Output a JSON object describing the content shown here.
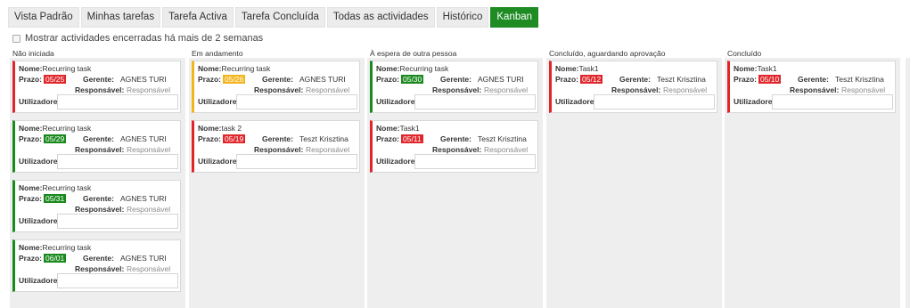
{
  "tabs": [
    {
      "label": "Vista Padrão"
    },
    {
      "label": "Minhas tarefas"
    },
    {
      "label": "Tarefa Activa"
    },
    {
      "label": "Tarefa Concluída"
    },
    {
      "label": "Todas as actividades"
    },
    {
      "label": "Histórico"
    },
    {
      "label": "Kanban",
      "active": true
    }
  ],
  "filter": {
    "show_closed_label": "Mostrar actividades encerradas há mais de 2 semanas",
    "checked": false
  },
  "labels": {
    "name": "Nome:",
    "deadline": "Prazo:",
    "manager": "Gerente:",
    "responsible": "Responsável:",
    "users": "Utilizadores:"
  },
  "colors": {
    "active_tab": "#1e8b23",
    "overdue": "#e0262b",
    "on_time": "#1a8a1f",
    "warning": "#f3b51d"
  },
  "columns": [
    {
      "title": "Não iniciada",
      "cards": [
        {
          "name": "Recurring task",
          "deadline": "05/25",
          "status": "red",
          "manager": "AGNES TURI",
          "responsible": "Responsável"
        },
        {
          "name": "Recurring task",
          "deadline": "05/29",
          "status": "green",
          "manager": "AGNES TURI",
          "responsible": "Responsável"
        },
        {
          "name": "Recurring task",
          "deadline": "05/31",
          "status": "green",
          "manager": "AGNES TURI",
          "responsible": "Responsável"
        },
        {
          "name": "Recurring task",
          "deadline": "06/01",
          "status": "green",
          "manager": "AGNES TURI",
          "responsible": "Responsável"
        }
      ]
    },
    {
      "title": "Em andamento",
      "cards": [
        {
          "name": "Recurring task",
          "deadline": "05/26",
          "status": "orange",
          "manager": "AGNES TURI",
          "responsible": "Responsável"
        },
        {
          "name": "task 2",
          "deadline": "05/19",
          "status": "red",
          "manager": "Teszt Krisztina",
          "responsible": "Responsável"
        }
      ]
    },
    {
      "title": "À espera de outra pessoa",
      "cards": [
        {
          "name": "Recurring task",
          "deadline": "05/30",
          "status": "green",
          "manager": "AGNES TURI",
          "responsible": "Responsável"
        },
        {
          "name": "Task1",
          "deadline": "05/11",
          "status": "red",
          "manager": "Teszt Krisztina",
          "responsible": "Responsável"
        }
      ]
    },
    {
      "title": "Concluído, aguardando aprovação",
      "cards": [
        {
          "name": "Task1",
          "deadline": "05/12",
          "status": "red",
          "manager": "Teszt Krisztina",
          "responsible": "Responsável"
        }
      ]
    },
    {
      "title": "Concluído",
      "cards": [
        {
          "name": "Task1",
          "deadline": "05/10",
          "status": "red",
          "manager": "Teszt Krisztina",
          "responsible": "Responsável"
        }
      ]
    }
  ]
}
